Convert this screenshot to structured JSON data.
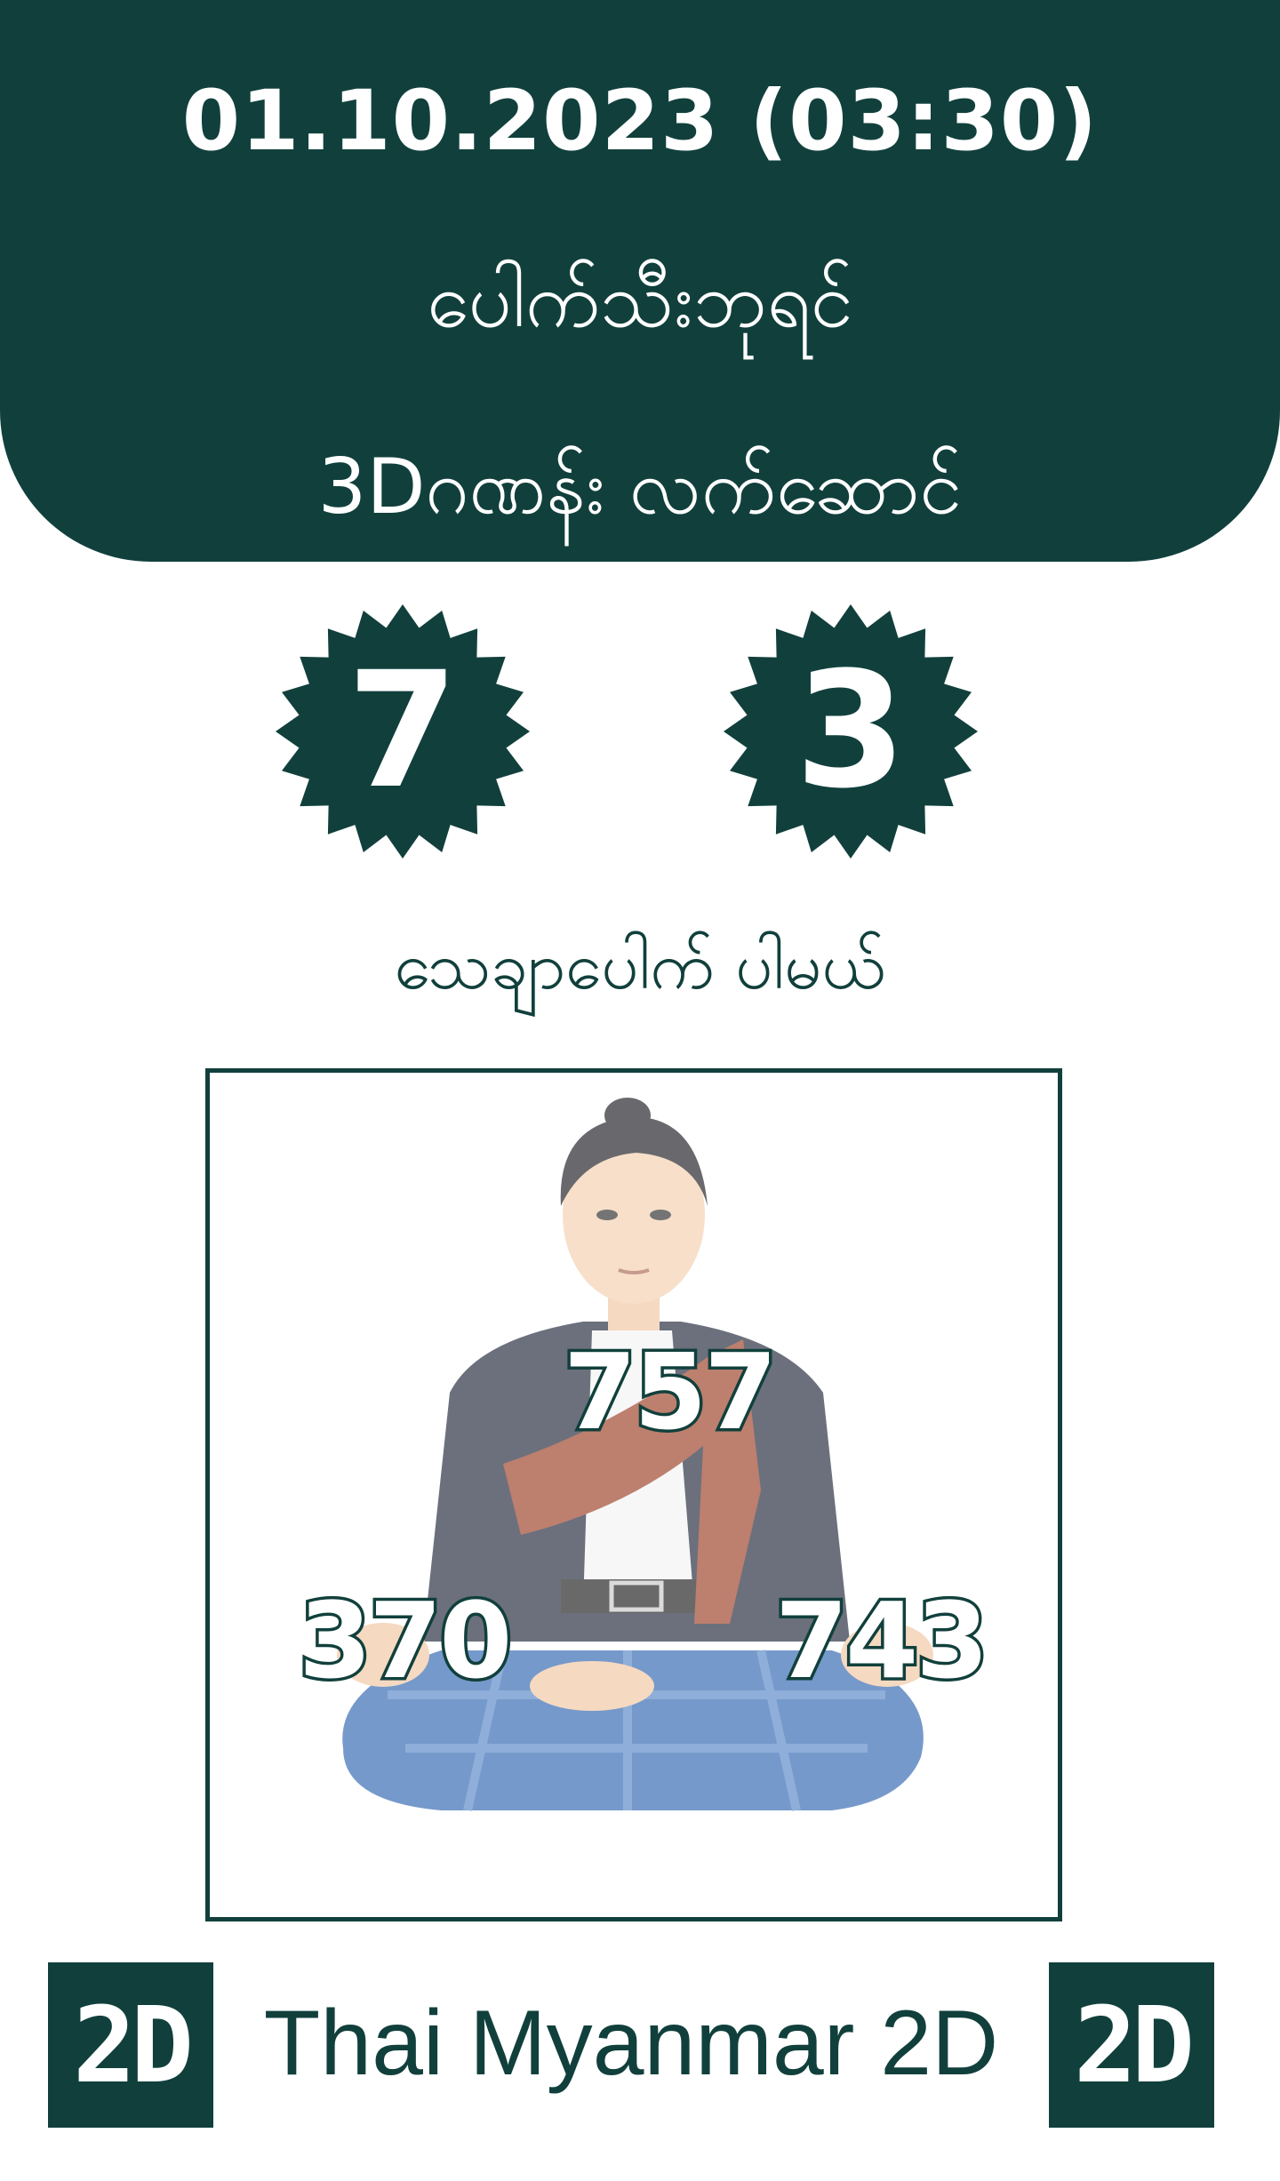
{
  "header": {
    "date_time": "01.10.2023 (03:30)",
    "subtitle_line1": "ပေါက်သီးဘုရင်",
    "subtitle_line2": "3Dဂဏန်း လက်ဆောင်"
  },
  "badges": [
    {
      "value": "7"
    },
    {
      "value": "3"
    }
  ],
  "caption": "သေချာပေါက် ပါမယ်",
  "picture": {
    "numbers": [
      "757",
      "370",
      "743"
    ]
  },
  "footer": {
    "brand": "Thai Myanmar 2D",
    "logo_left": "2D",
    "logo_right": "2D"
  },
  "colors": {
    "primary": "#11403c",
    "background": "#ffffff"
  }
}
